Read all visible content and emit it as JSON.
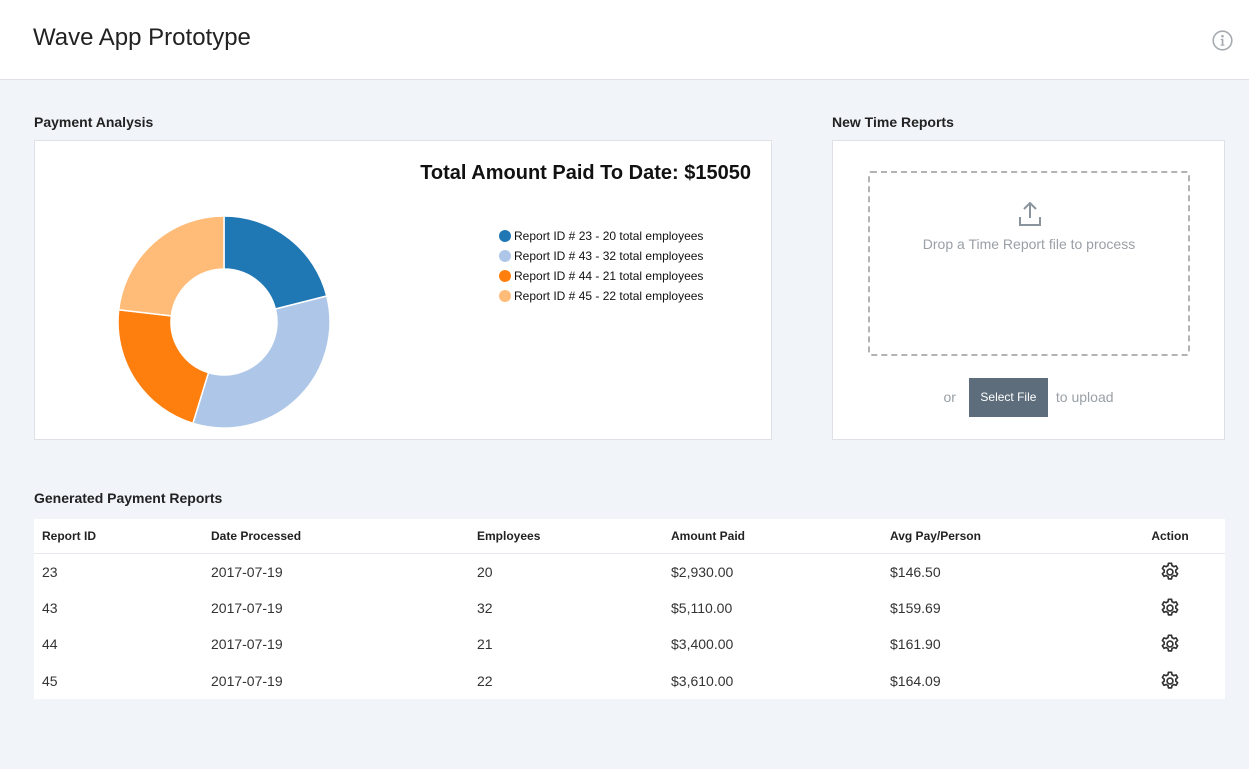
{
  "header": {
    "title": "Wave App Prototype",
    "info_icon": "info-icon"
  },
  "payment_analysis": {
    "section_title": "Payment Analysis"
  },
  "chart_data": {
    "type": "pie",
    "title": "Total Amount Paid To Date: $15050",
    "donut": true,
    "categories": [
      "Report ID # 23 - 20 total employees",
      "Report ID # 43 - 32 total employees",
      "Report ID # 44 - 21 total employees",
      "Report ID # 45 - 22 total employees"
    ],
    "values": [
      20,
      32,
      21,
      22
    ],
    "colors": [
      "#1f77b4",
      "#aec7e8",
      "#ff7f0e",
      "#ffbb78"
    ],
    "legend_position": "top-right"
  },
  "time_reports": {
    "section_title": "New Time Reports",
    "upload_icon": "upload-icon",
    "dropzone_text": "Drop a Time Report file to process",
    "or_text": "or",
    "select_button": "Select File",
    "to_upload_text": "to upload"
  },
  "reports_table": {
    "section_title": "Generated Payment Reports",
    "columns": [
      "Report ID",
      "Date Processed",
      "Employees",
      "Amount Paid",
      "Avg Pay/Person",
      "Action"
    ],
    "rows": [
      {
        "id": "23",
        "date": "2017-07-19",
        "employees": "20",
        "amount": "$2,930.00",
        "avg": "$146.50",
        "action_icon": "gear-icon"
      },
      {
        "id": "43",
        "date": "2017-07-19",
        "employees": "32",
        "amount": "$5,110.00",
        "avg": "$159.69",
        "action_icon": "gear-icon"
      },
      {
        "id": "44",
        "date": "2017-07-19",
        "employees": "21",
        "amount": "$3,400.00",
        "avg": "$161.90",
        "action_icon": "gear-icon"
      },
      {
        "id": "45",
        "date": "2017-07-19",
        "employees": "22",
        "amount": "$3,610.00",
        "avg": "$164.09",
        "action_icon": "gear-icon"
      }
    ]
  }
}
